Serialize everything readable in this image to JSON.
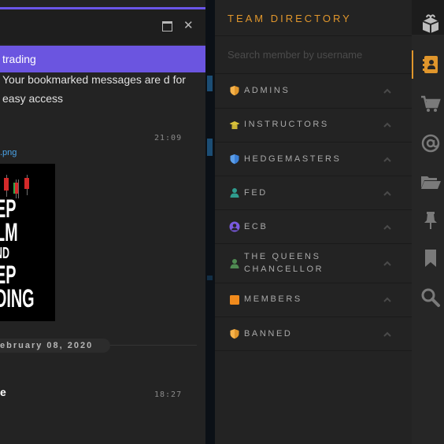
{
  "chat": {
    "banner_text": "trading",
    "message_text": "Your bookmarked messages are d for easy access",
    "message_time": "21:09",
    "attachment_name": ".png",
    "image_caption_lines": [
      "EP",
      "LM",
      "ND",
      "EP",
      "DING"
    ],
    "date_separator": "ebruary 08, 2020",
    "last_message_text": "e",
    "last_message_time": "18:27"
  },
  "directory": {
    "title": "TEAM DIRECTORY",
    "search_placeholder": "Search member by username",
    "groups": [
      {
        "label": "ADMINS",
        "icon": "shield-icon"
      },
      {
        "label": "INSTRUCTORS",
        "icon": "graduation-cap-icon"
      },
      {
        "label": "HEDGEMASTERS",
        "icon": "shield-check-icon"
      },
      {
        "label": "FED",
        "icon": "person-icon"
      },
      {
        "label": "ECB",
        "icon": "circle-user-icon"
      },
      {
        "label": "THE QUEENS",
        "label2": "CHANCELLOR",
        "icon": "person-icon"
      },
      {
        "label": "MEMBERS",
        "icon": "square-icon"
      },
      {
        "label": "BANNED",
        "icon": "shield-icon"
      }
    ]
  },
  "rail": {
    "icons": [
      "box-icon",
      "contacts-icon",
      "cart-icon",
      "at-icon",
      "folder-icon",
      "pin-icon",
      "bookmark-icon",
      "search-icon"
    ],
    "active": "contacts-icon"
  },
  "colors": {
    "accent_orange": "#e0962c",
    "accent_purple": "#6b55e0",
    "link_blue": "#4aa3e8",
    "panel_bg": "#232323"
  }
}
